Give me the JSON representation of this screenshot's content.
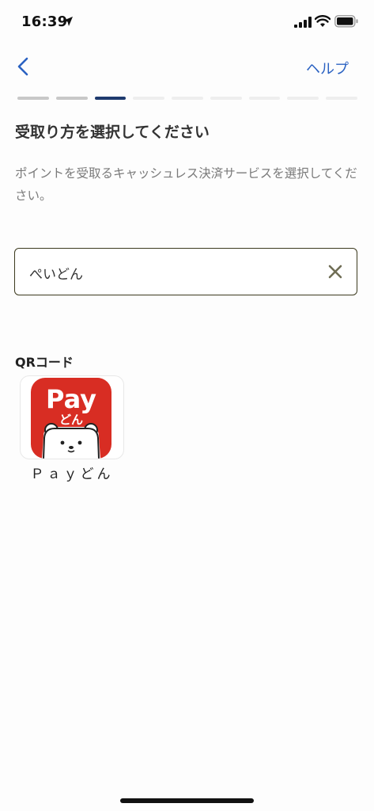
{
  "status_bar": {
    "time": "16:39"
  },
  "nav": {
    "help_label": "ヘルプ"
  },
  "progress": {
    "total_steps": 9,
    "current_step": 3
  },
  "page": {
    "title": "受取り方を選択してください",
    "description": "ポイントを受取るキャッシュレス決済サービスを選択してください。"
  },
  "search": {
    "value": "ぺいどん"
  },
  "section": {
    "title": "QRコード",
    "services": [
      {
        "name": "Ｐａｙどん",
        "logo_text": "Pay",
        "logo_subtext": "どん",
        "brand_color": "#d82d23"
      }
    ]
  },
  "colors": {
    "accent": "#2b62c2",
    "progress_active": "#1e3a6e",
    "progress_done": "#c8c8c8",
    "progress_todo": "#eeeeee"
  }
}
